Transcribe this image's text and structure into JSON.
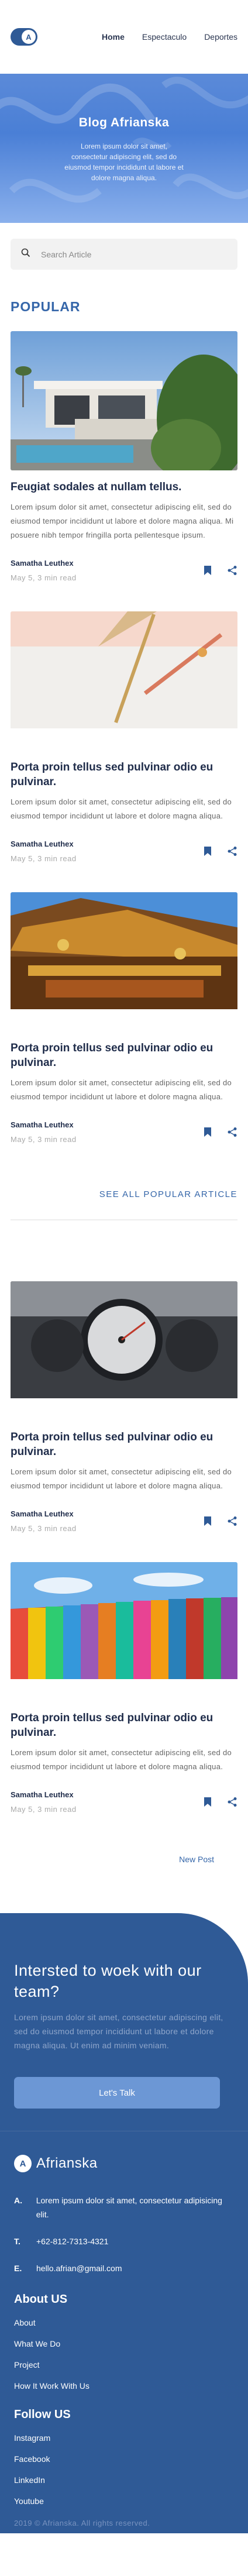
{
  "nav": {
    "logo_letter": "A",
    "links": [
      "Home",
      "Espectaculo",
      "Deportes"
    ]
  },
  "hero": {
    "title": "Blog Afrianska",
    "subtitle": "Lorem ipsum dolor sit amet, consectetur adipiscing elit, sed do eiusmod tempor incididunt ut labore et dolore magna aliqua."
  },
  "search": {
    "placeholder": "Search Article"
  },
  "popular": {
    "title": "POPULAR",
    "articles": [
      {
        "image": "modern-house-photo",
        "title": "Feugiat sodales at nullam tellus.",
        "desc": "Lorem ipsum dolor sit amet, consectetur adipiscing elit, sed do eiusmod tempor incididunt ut labore et dolore magna aliqua. Mi posuere nibh tempor fringilla porta pellentesque ipsum.",
        "author": "Samatha Leuthex",
        "date": "May 5, 3 min read"
      },
      {
        "image": "pens-on-desk-photo",
        "title": "Porta proin tellus sed pulvinar odio eu pulvinar.",
        "desc": "Lorem ipsum dolor sit amet, consectetur adipiscing elit, sed do eiusmod tempor incididunt ut labore et dolore magna aliqua.",
        "author": "Samatha Leuthex",
        "date": "May 5, 3 min read"
      },
      {
        "image": "temple-roof-photo",
        "title": "Porta proin tellus sed pulvinar odio eu pulvinar.",
        "desc": "Lorem ipsum dolor sit amet, consectetur adipiscing elit, sed do eiusmod tempor incididunt ut labore et dolore magna aliqua.",
        "author": "Samatha Leuthex",
        "date": "May 5, 3 min read"
      }
    ],
    "see_all": "SEE ALL POPULAR ARTICLE"
  },
  "recent": {
    "articles": [
      {
        "image": "car-gauge-photo",
        "title": "Porta proin tellus sed pulvinar odio eu pulvinar.",
        "desc": "Lorem ipsum dolor sit amet, consectetur adipiscing elit, sed do eiusmod tempor incididunt ut labore et dolore magna aliqua.",
        "author": "Samatha Leuthex",
        "date": "May 5, 3 min read"
      },
      {
        "image": "colorful-building-photo",
        "title": "Porta proin tellus sed pulvinar odio eu pulvinar.",
        "desc": "Lorem ipsum dolor sit amet, consectetur adipiscing elit, sed do eiusmod tempor incididunt ut labore et dolore magna aliqua.",
        "author": "Samatha Leuthex",
        "date": "May 5, 3 min read"
      }
    ],
    "new_post": "New Post"
  },
  "cta": {
    "title": "Intersted to woek with our team?",
    "text": "Lorem ipsum dolor sit amet, consectetur adipiscing elit, sed do eiusmod tempor incididunt ut labore et dolore magna aliqua. Ut enim ad minim veniam.",
    "button": "Let's Talk"
  },
  "footer": {
    "logo_letter": "A",
    "logo_text": "Afrianska",
    "contacts": [
      {
        "label": "A.",
        "value": "Lorem ipsum dolor sit amet, consectetur adipisicing elit."
      },
      {
        "label": "T.",
        "value": "+62-812-7313-4321"
      },
      {
        "label": "E.",
        "value": "hello.afrian@gmail.com"
      }
    ],
    "about_title": "About US",
    "about_links": [
      "About",
      "What We Do",
      "Project",
      "How It Work With Us"
    ],
    "follow_title": "Follow US",
    "follow_links": [
      "Instagram",
      "Facebook",
      "LinkedIn",
      "Youtube"
    ],
    "copyright": "2019 © Afrianska. All rights reserved."
  },
  "colors": {
    "primary": "#2f5a96",
    "accent": "#3566a9",
    "button": "#6c97d5"
  }
}
